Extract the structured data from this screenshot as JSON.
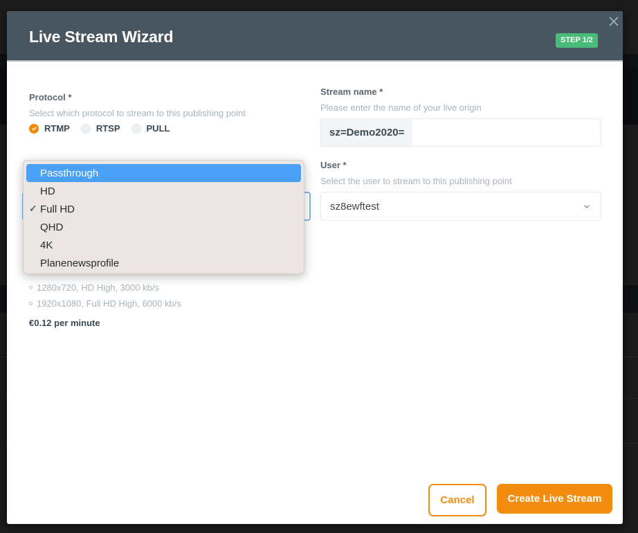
{
  "modal": {
    "title": "Live Stream Wizard",
    "step_badge": "STEP 1/2",
    "close_icon": "close-icon"
  },
  "protocol": {
    "label": "Protocol *",
    "help": "Select which protocol to stream to this publishing point",
    "options": [
      {
        "label": "RTMP",
        "checked": true
      },
      {
        "label": "RTSP",
        "checked": false
      },
      {
        "label": "PULL",
        "checked": false
      }
    ]
  },
  "stream_name": {
    "label": "Stream name *",
    "help": "Please enter the name of your live origin",
    "prefix": "sz=Demo2020=",
    "value": "",
    "placeholder": ""
  },
  "user": {
    "label": "User *",
    "help": "Select the user to stream to this publishing point",
    "selected": "sz8ewftest"
  },
  "profile": {
    "selected": "Full HD",
    "dropdown_open": true,
    "highlighted": "Passthrough",
    "options": [
      "Passthrough",
      "HD",
      "Full HD",
      "QHD",
      "4K",
      "Planenewsprofile"
    ],
    "bitrates": [
      "1280x720, HD High, 3000 kb/s",
      "1920x1080, Full HD High, 6000 kb/s"
    ],
    "price": "€0.12 per minute"
  },
  "footer": {
    "cancel_label": "Cancel",
    "create_label": "Create Live Stream"
  },
  "colors": {
    "header_bg": "#475660",
    "accent_orange": "#f28d10",
    "badge_green": "#48bb78",
    "highlight_blue": "#4aa0f5"
  }
}
